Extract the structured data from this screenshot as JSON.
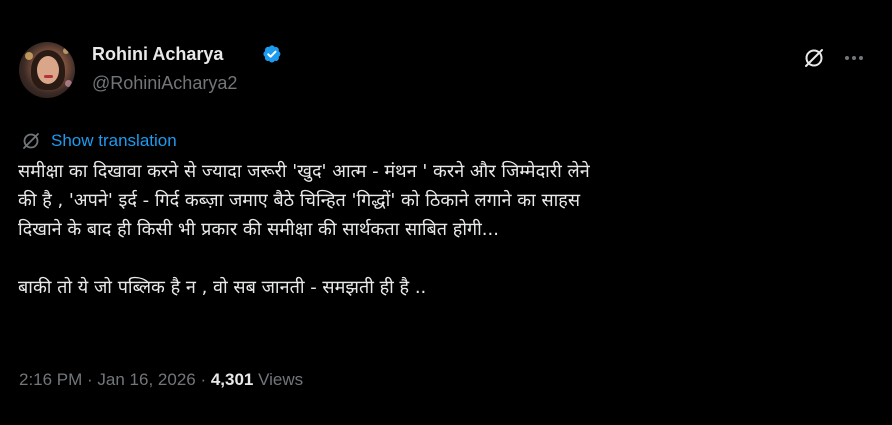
{
  "author": {
    "display_name": "Rohini Acharya",
    "handle": "@RohiniAcharya2",
    "verified_icon": "verified-badge-icon",
    "verified_color": "#1d9bf0"
  },
  "actions": {
    "grok_icon": "grok-icon",
    "more_icon": "more-icon"
  },
  "translation": {
    "label": "Show translation",
    "icon": "translate-icon",
    "color": "#1d9bf0"
  },
  "tweet": {
    "lines": [
      "समीक्षा का दिखावा करने से ज्यादा जरूरी 'खुद' आत्म - मंथन ' करने और जिम्मेदारी लेने",
      "की है , 'अपने' इर्द - गिर्द कब्ज़ा जमाए बैठे चिन्हित 'गिद्धों' को ठिकाने लगाने का साहस",
      "दिखाने के बाद ही किसी भी प्रकार की समीक्षा की सार्थकता साबित होगी...",
      "",
      "बाकी तो ये जो पब्लिक है न , वो सब जानती - समझती ही है .."
    ]
  },
  "meta": {
    "time": "2:16 PM",
    "separator": " · ",
    "date": "Jan 16, 2026",
    "views_count": "4,301",
    "views_label": " Views"
  }
}
